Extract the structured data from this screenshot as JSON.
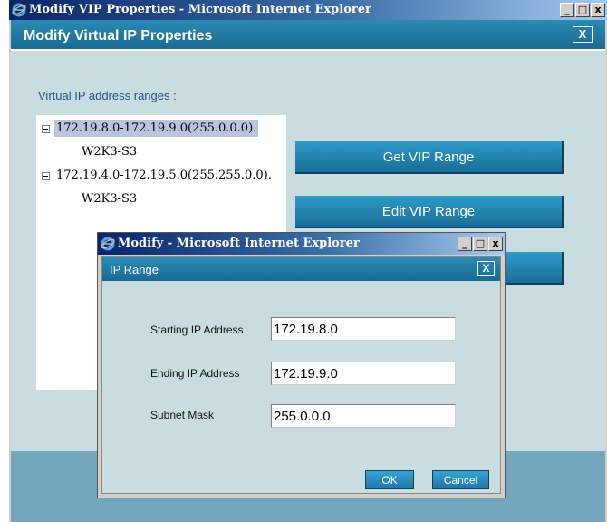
{
  "outer_window": {
    "title": "Modify VIP Properties - Microsoft Internet Explorer",
    "caption_buttons": {
      "minimize": "_",
      "maximize": "□",
      "close": "x"
    },
    "header_title": "Modify Virtual IP Properties",
    "header_close": "X",
    "section_label": "Virtual IP address ranges :",
    "tree": [
      {
        "label": "172.19.8.0-172.19.9.0(255.0.0.0).",
        "selected": true,
        "child": "W2K3-S3"
      },
      {
        "label": "172.19.4.0-172.19.5.0(255.255.0.0).",
        "selected": false,
        "child": "W2K3-S3"
      }
    ],
    "buttons": {
      "get_vip_range": "Get VIP Range",
      "edit_vip_range": "Edit VIP Range"
    }
  },
  "inner_window": {
    "title": "Modify - Microsoft Internet Explorer",
    "caption_buttons": {
      "minimize": "_",
      "maximize": "□",
      "close": "x"
    },
    "header_title": "IP Range",
    "header_close": "X",
    "fields": {
      "starting_ip": {
        "label": "Starting IP Address",
        "value": "172.19.8.0"
      },
      "ending_ip": {
        "label": "Ending IP Address",
        "value": "172.19.9.0"
      },
      "subnet_mask": {
        "label": "Subnet Mask",
        "value": "255.0.0.0"
      }
    },
    "buttons": {
      "ok": "OK",
      "cancel": "Cancel"
    }
  },
  "icons": [
    "ie-logo-icon",
    "tree-collapse-icon"
  ],
  "colors": {
    "titlebar_dark": "#0a246a",
    "titlebar_light": "#a6caf0",
    "dialog_bg": "#c9dde0",
    "accent_blue": "#1a6d9a",
    "selection": "#b8c4e0"
  }
}
